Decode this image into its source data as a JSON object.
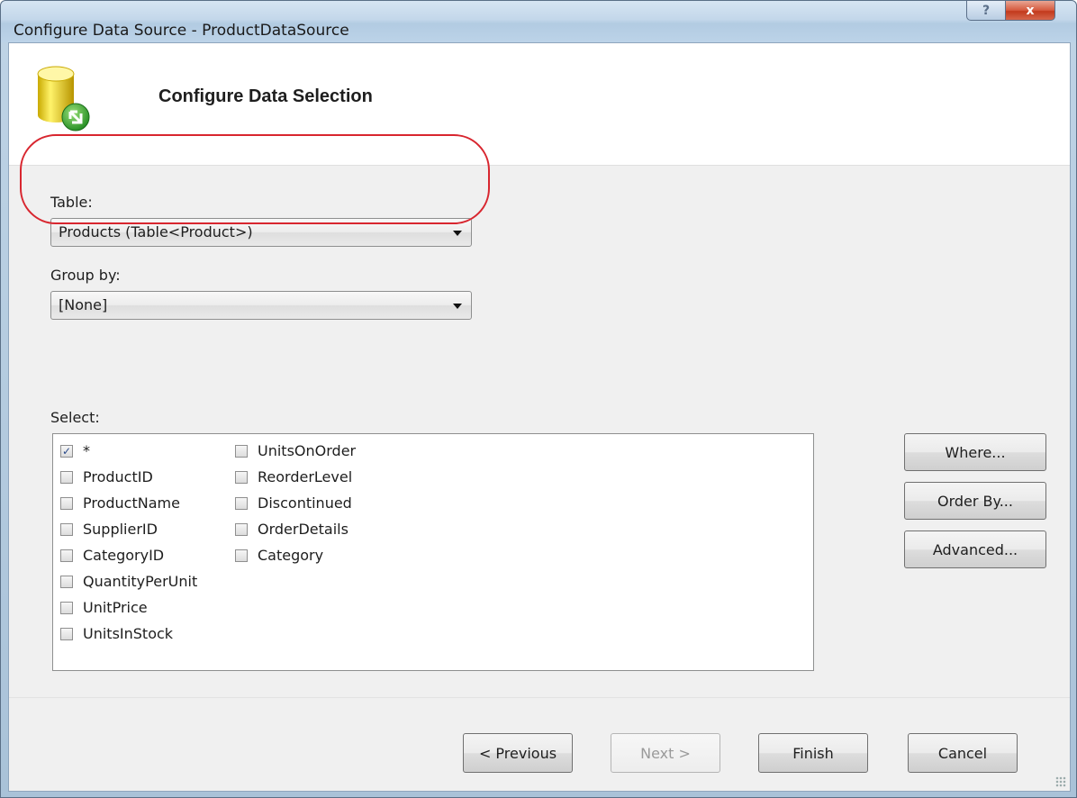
{
  "window": {
    "title": "Configure Data Source - ProductDataSource",
    "help_glyph": "?",
    "close_glyph": "x"
  },
  "header": {
    "title": "Configure Data Selection",
    "icon": "database-icon"
  },
  "table": {
    "label": "Table:",
    "value": "Products (Table<Product>)"
  },
  "group_by": {
    "label": "Group by:",
    "value": "[None]"
  },
  "select": {
    "label": "Select:",
    "column1": [
      {
        "label": "*",
        "checked": true
      },
      {
        "label": "ProductID",
        "checked": false
      },
      {
        "label": "ProductName",
        "checked": false
      },
      {
        "label": "SupplierID",
        "checked": false
      },
      {
        "label": "CategoryID",
        "checked": false
      },
      {
        "label": "QuantityPerUnit",
        "checked": false
      },
      {
        "label": "UnitPrice",
        "checked": false
      },
      {
        "label": "UnitsInStock",
        "checked": false
      }
    ],
    "column2": [
      {
        "label": "UnitsOnOrder",
        "checked": false
      },
      {
        "label": "ReorderLevel",
        "checked": false
      },
      {
        "label": "Discontinued",
        "checked": false
      },
      {
        "label": "OrderDetails",
        "checked": false
      },
      {
        "label": "Category",
        "checked": false
      }
    ]
  },
  "side_buttons": {
    "where": "Where...",
    "order_by": "Order By...",
    "advanced": "Advanced..."
  },
  "footer": {
    "previous": "< Previous",
    "next": "Next >",
    "finish": "Finish",
    "cancel": "Cancel"
  },
  "colors": {
    "highlight": "#d8262f",
    "title_bar": "#c3d7ea"
  }
}
